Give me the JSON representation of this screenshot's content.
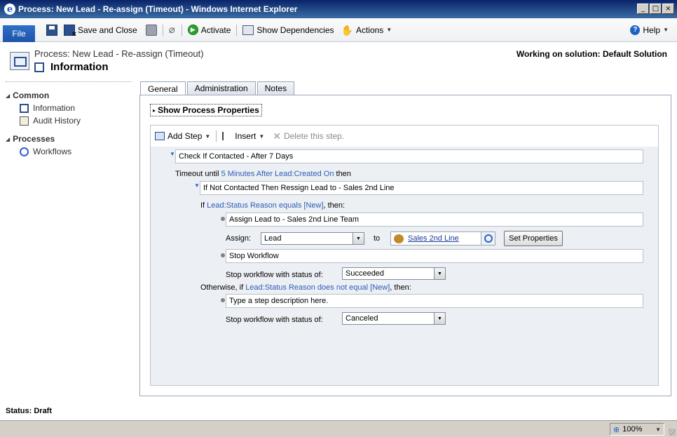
{
  "window": {
    "title": "Process: New Lead - Re-assign (Timeout) - Windows Internet Explorer",
    "minimize": "_",
    "maximize": "□",
    "close": "×"
  },
  "toolbar": {
    "file": "File",
    "save_and_close": "Save and Close",
    "activate": "Activate",
    "show_dependencies": "Show Dependencies",
    "actions": "Actions",
    "help": "Help"
  },
  "header": {
    "subtitle": "Process: New Lead - Re-assign (Timeout)",
    "title": "Information",
    "solution": "Working on solution: Default Solution"
  },
  "nav": {
    "common": "Common",
    "common_items": [
      "Information",
      "Audit History"
    ],
    "processes": "Processes",
    "process_items": [
      "Workflows"
    ]
  },
  "tabs": [
    "General",
    "Administration",
    "Notes"
  ],
  "show_props": "Show Process Properties",
  "designer": {
    "add_step": "Add Step",
    "insert": "Insert",
    "delete_step": "Delete this step.",
    "step1": "Check If Contacted - After 7 Days",
    "timeout_prefix": "Timeout until ",
    "timeout_link": "5 Minutes After Lead:Created On",
    "timeout_suffix": " then",
    "step2": "If Not Contacted Then Ressign Lead to - Sales 2nd Line",
    "if_prefix": "If ",
    "if_link": "Lead:Status Reason equals [New]",
    "if_suffix": ", then:",
    "assign_step": "Assign Lead to - Sales 2nd Line Team",
    "assign_label": "Assign:",
    "assign_value": "Lead",
    "to_label": "to",
    "assign_team": "Sales 2nd Line",
    "set_properties": "Set Properties",
    "stop_step": "Stop Workflow",
    "stop_label": "Stop workflow with status of:",
    "stop_value1": "Succeeded",
    "otherwise_prefix": "Otherwise, if ",
    "otherwise_link": "Lead:Status Reason does not equal [New]",
    "otherwise_suffix": ", then:",
    "placeholder_step": "Type a step description here.",
    "stop_value2": "Canceled"
  },
  "status": {
    "label": "Status:",
    "value": "Draft"
  },
  "browser": {
    "zoom": "100%"
  }
}
